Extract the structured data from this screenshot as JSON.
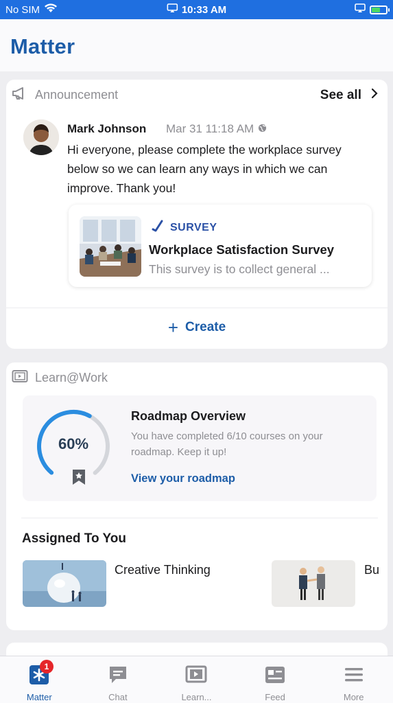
{
  "status": {
    "carrier": "No SIM",
    "time": "10:33 AM"
  },
  "app": {
    "title": "Matter"
  },
  "announcement": {
    "section_title": "Announcement",
    "see_all": "See all",
    "author": "Mark Johnson",
    "timestamp": "Mar 31 11:18 AM",
    "body": "Hi everyone, please complete the workplace survey below so we can learn any ways in which we can improve. Thank you!",
    "survey": {
      "tag": "SURVEY",
      "title": "Workplace Satisfaction Survey",
      "description": "This survey is to collect general ..."
    },
    "create_label": "Create"
  },
  "learn": {
    "section_title": "Learn@Work",
    "roadmap": {
      "progress_percent": 60,
      "progress_text": "60%",
      "title": "Roadmap Overview",
      "description": "You have completed 6/10 courses on your roadmap. Keep it up!",
      "link": "View your roadmap"
    },
    "assigned_title": "Assigned To You",
    "courses": [
      {
        "label": "Creative Thinking"
      },
      {
        "label": "Bu"
      }
    ]
  },
  "tabs": [
    {
      "label": "Matter",
      "icon": "matter-logo-icon",
      "badge": "1",
      "active": true
    },
    {
      "label": "Chat",
      "icon": "chat-icon"
    },
    {
      "label": "Learn...",
      "icon": "learn-play-icon"
    },
    {
      "label": "Feed",
      "icon": "feed-card-icon"
    },
    {
      "label": "More",
      "icon": "hamburger-menu-icon"
    }
  ],
  "colors": {
    "brand": "#1d5da8",
    "status_bar": "#1f6fe0",
    "badge": "#e5262a"
  }
}
